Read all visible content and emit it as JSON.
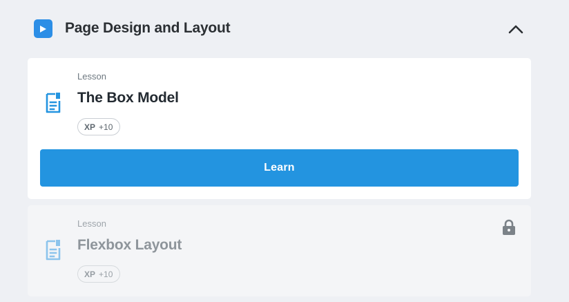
{
  "section": {
    "title": "Page Design and Layout",
    "badge_icon": "play-icon",
    "toggle_icon": "chevron-up-icon",
    "accent_color": "#2c8ee6"
  },
  "lessons": [
    {
      "kind": "Lesson",
      "title": "The Box Model",
      "xp_label": "XP",
      "xp_value": "+10",
      "icon": "document-icon",
      "state": "active",
      "action_label": "Learn",
      "action_color": "#2394e0"
    },
    {
      "kind": "Lesson",
      "title": "Flexbox Layout",
      "xp_label": "XP",
      "xp_value": "+10",
      "icon": "document-icon",
      "state": "locked",
      "status_icon": "lock-icon"
    }
  ]
}
